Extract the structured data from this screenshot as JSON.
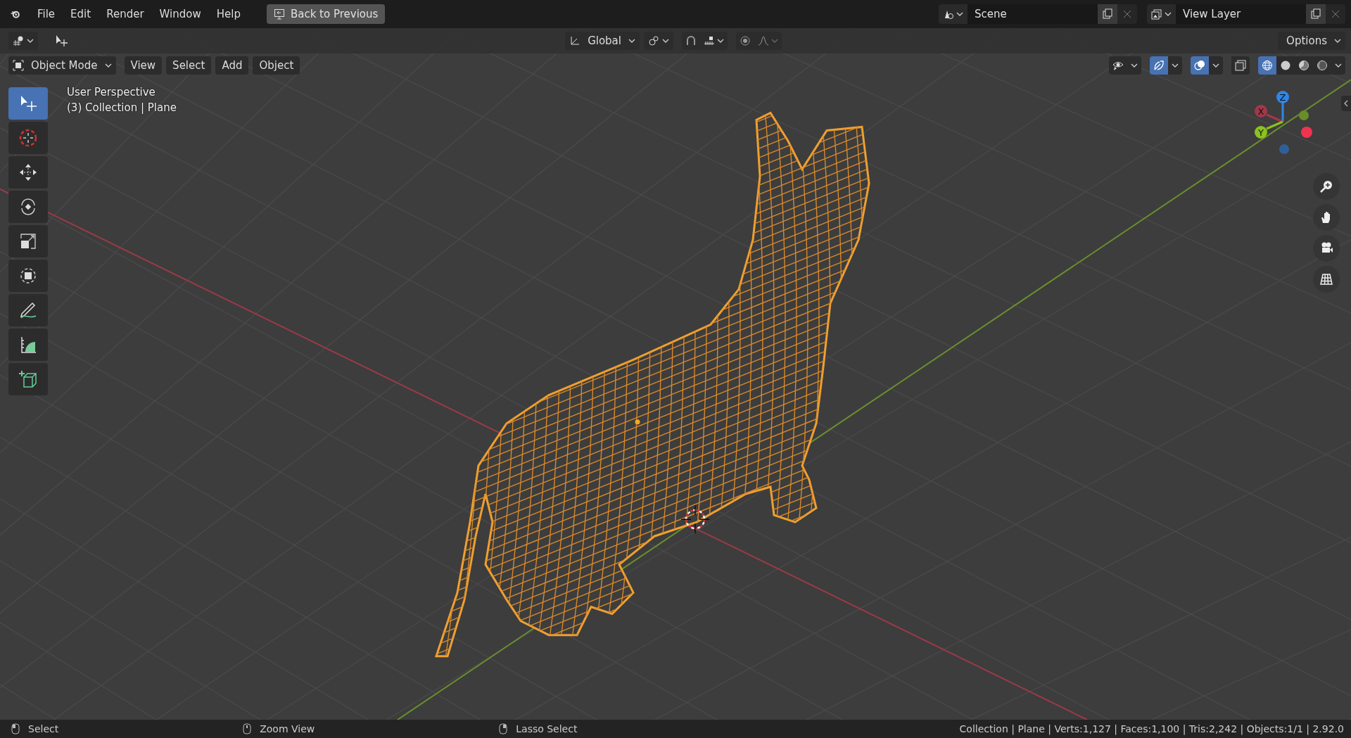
{
  "top_bar": {
    "menus": [
      "File",
      "Edit",
      "Render",
      "Window",
      "Help"
    ],
    "back_button": "Back to Previous",
    "scene": "Scene",
    "view_layer": "View Layer"
  },
  "tool_header": {
    "orientation": "Global",
    "snap": {
      "on": false
    },
    "proportional": {
      "on": false
    },
    "options": "Options"
  },
  "view_header": {
    "mode": "Object Mode",
    "menus": [
      "View",
      "Select",
      "Add",
      "Object"
    ],
    "toggles": [
      {
        "kind": "visibility",
        "on": false
      },
      {
        "kind": "gizmo",
        "on": true
      },
      {
        "kind": "overlay",
        "on": true
      },
      {
        "kind": "xray",
        "on": false
      }
    ],
    "shading": [
      {
        "kind": "wireframe",
        "selected": true
      },
      {
        "kind": "solid",
        "selected": false
      },
      {
        "kind": "material",
        "selected": false
      },
      {
        "kind": "rendered",
        "selected": false
      }
    ]
  },
  "viewport": {
    "info": [
      "User Perspective",
      "(3) Collection | Plane"
    ],
    "tools": [
      {
        "kind": "select",
        "selected": true
      },
      {
        "kind": "cursor",
        "selected": false
      },
      {
        "kind": "move",
        "selected": false
      },
      {
        "kind": "rotate",
        "selected": false
      },
      {
        "kind": "scale",
        "selected": false
      },
      {
        "kind": "transform",
        "selected": false
      },
      {
        "kind": "annotate",
        "selected": false
      },
      {
        "kind": "measure",
        "selected": false
      },
      {
        "kind": "add_cube",
        "selected": false
      }
    ],
    "axes": [
      {
        "kind": "x",
        "label": "X"
      },
      {
        "kind": "y",
        "label": "Y"
      },
      {
        "kind": "z",
        "label": "Z"
      }
    ],
    "nav_buttons": [
      {
        "kind": "zoom"
      },
      {
        "kind": "pan"
      },
      {
        "kind": "camera"
      },
      {
        "kind": "ortho"
      }
    ]
  },
  "status_bar": {
    "hints": [
      {
        "kind": "left",
        "label": "Select"
      },
      {
        "kind": "middle",
        "label": "Zoom View"
      },
      {
        "kind": "right",
        "label": "Lasso Select"
      }
    ],
    "stats": "Collection | Plane | Verts:1,127 | Faces:1,100 | Tris:2,242 | Objects:1/1 | 2.92.0"
  }
}
